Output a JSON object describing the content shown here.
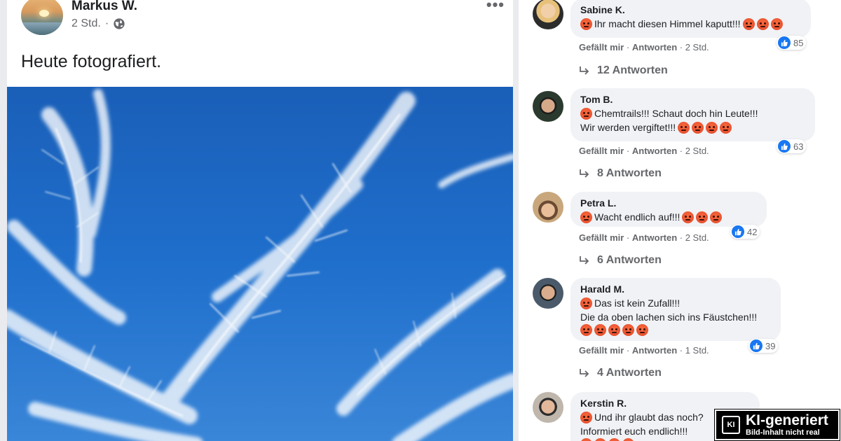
{
  "post": {
    "author": "Markus W.",
    "time": "2 Std.",
    "separator": "·",
    "privacy_icon": "globe-icon",
    "more_icon": "more-horizontal-icon",
    "text": "Heute fotografiert.",
    "photo_subject": "cirrus clouds blue sky"
  },
  "comments": [
    {
      "name": "Sabine K.",
      "lines": [
        {
          "pre": 1,
          "text": "Ihr macht diesen Himmel kaputt!!!",
          "post": 3
        }
      ],
      "like_label": "Gefällt mir",
      "reply_label": "Antworten",
      "time": "2 Std.",
      "likes": "85",
      "replies": "12 Antworten"
    },
    {
      "name": "Tom B.",
      "lines": [
        {
          "pre": 1,
          "text": "Chemtrails!!! Schaut doch hin Leute!!!",
          "post": 0
        },
        {
          "pre": 0,
          "text": "Wir werden vergiftet!!!",
          "post": 4
        }
      ],
      "like_label": "Gefällt mir",
      "reply_label": "Antworten",
      "time": "2 Std.",
      "likes": "63",
      "replies": "8 Antworten"
    },
    {
      "name": "Petra L.",
      "lines": [
        {
          "pre": 1,
          "text": "Wacht endlich auf!!!",
          "post": 3
        }
      ],
      "like_label": "Gefällt mir",
      "reply_label": "Antworten",
      "time": "2 Std.",
      "likes": "42",
      "replies": "6 Antworten"
    },
    {
      "name": "Harald M.",
      "lines": [
        {
          "pre": 1,
          "text": "Das ist kein Zufall!!!",
          "post": 0
        },
        {
          "pre": 0,
          "text": "Die da oben lachen sich ins Fäustchen!!!",
          "post": 0
        },
        {
          "pre": 0,
          "text": "",
          "post": 5
        }
      ],
      "like_label": "Gefällt mir",
      "reply_label": "Antworten",
      "time": "1 Std.",
      "likes": "39",
      "replies": "4 Antworten"
    },
    {
      "name": "Kerstin R.",
      "lines": [
        {
          "pre": 1,
          "text": "Und ihr glaubt das noch?",
          "post": 0
        },
        {
          "pre": 0,
          "text": "Informiert euch endlich!!!",
          "post": 0
        },
        {
          "pre": 0,
          "text": "",
          "post": 4
        }
      ]
    }
  ],
  "emoji_name": "angry-face-emoji",
  "like_icon": "thumbs-up-icon",
  "reply_icon": "reply-arrow-icon",
  "badge": {
    "chip": "KI",
    "title": "KI-generiert",
    "subtitle": "Bild-Inhalt nicht real"
  },
  "colors": {
    "brand_blue": "#1877f2",
    "bubble": "#f0f2f5",
    "angry": "#e2452a",
    "muted_text": "#65676b"
  }
}
